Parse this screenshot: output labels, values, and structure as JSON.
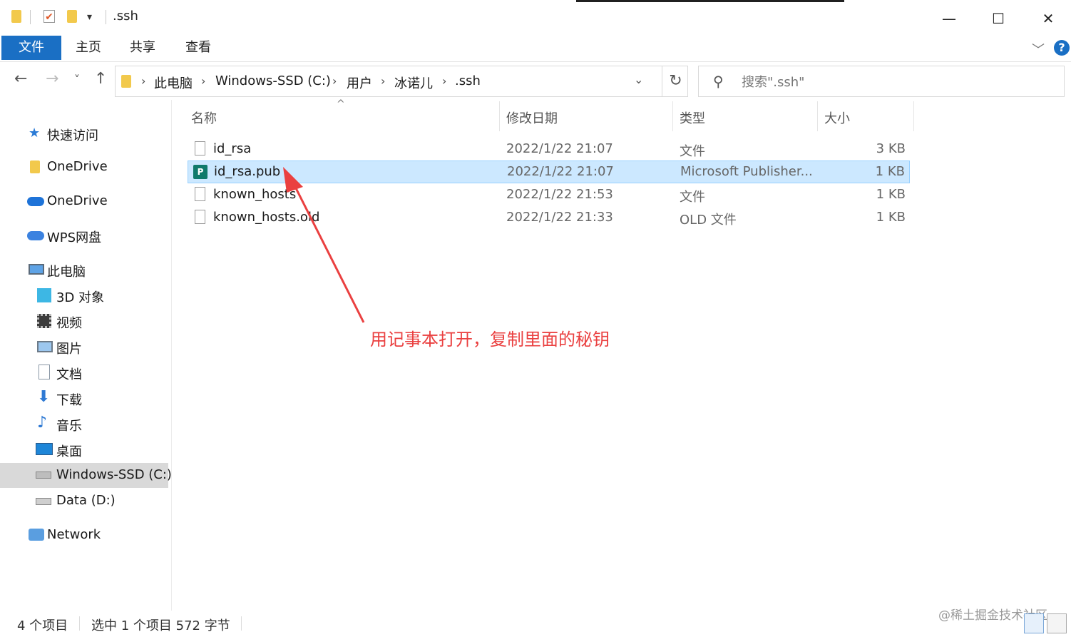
{
  "window": {
    "title": ".ssh",
    "qat_dropdown": "▾",
    "minimize": "—",
    "maximize": "☐",
    "close": "✕"
  },
  "ribbon": {
    "tabs": [
      "文件",
      "主页",
      "共享",
      "查看"
    ],
    "expand_chevron": "﹀",
    "help": "?"
  },
  "nav": {
    "back": "←",
    "forward": "→",
    "recent": "˅",
    "up": "↑"
  },
  "address": {
    "crumbs": [
      "此电脑",
      "Windows-SSD (C:)",
      "用户",
      "冰诺儿",
      ".ssh"
    ],
    "separator": "›",
    "dropdown": "⌄",
    "refresh": "↻"
  },
  "search": {
    "placeholder": "搜索\".ssh\""
  },
  "sidebar": {
    "items": [
      {
        "label": "快速访问",
        "icon": "star-icon"
      },
      {
        "label": "OneDrive",
        "icon": "folder-icon"
      },
      {
        "label": "OneDrive",
        "icon": "cloud-icon"
      },
      {
        "label": "WPS网盘",
        "icon": "cloud-icon"
      },
      {
        "label": "此电脑",
        "icon": "computer-icon"
      },
      {
        "label": "3D 对象",
        "icon": "cube-icon"
      },
      {
        "label": "视频",
        "icon": "film-icon"
      },
      {
        "label": "图片",
        "icon": "picture-icon"
      },
      {
        "label": "文档",
        "icon": "document-icon"
      },
      {
        "label": "下载",
        "icon": "download-icon"
      },
      {
        "label": "音乐",
        "icon": "music-icon"
      },
      {
        "label": "桌面",
        "icon": "desktop-icon"
      },
      {
        "label": "Windows-SSD (C:)",
        "icon": "drive-icon"
      },
      {
        "label": "Data (D:)",
        "icon": "drive-icon"
      },
      {
        "label": "Network",
        "icon": "network-icon"
      }
    ]
  },
  "filelist": {
    "columns": [
      "名称",
      "修改日期",
      "类型",
      "大小"
    ],
    "sort_indicator": "^",
    "rows": [
      {
        "name": "id_rsa",
        "date": "2022/1/22 21:07",
        "type": "文件",
        "size": "3 KB"
      },
      {
        "name": "id_rsa.pub",
        "date": "2022/1/22 21:07",
        "type": "Microsoft Publisher...",
        "size": "1 KB"
      },
      {
        "name": "known_hosts",
        "date": "2022/1/22 21:53",
        "type": "文件",
        "size": "1 KB"
      },
      {
        "name": "known_hosts.old",
        "date": "2022/1/22 21:33",
        "type": "OLD 文件",
        "size": "1 KB"
      }
    ]
  },
  "annotation": {
    "text": "用记事本打开，复制里面的秘钥",
    "color": "#ea4040"
  },
  "status": {
    "count": "4 个项目",
    "selection": "选中 1 个项目  572 字节",
    "watermark": "@稀土掘金技术社区"
  },
  "colors": {
    "accent": "#1a6fc4",
    "selection_bg": "#cce8ff",
    "selection_border": "#99d1ff"
  }
}
